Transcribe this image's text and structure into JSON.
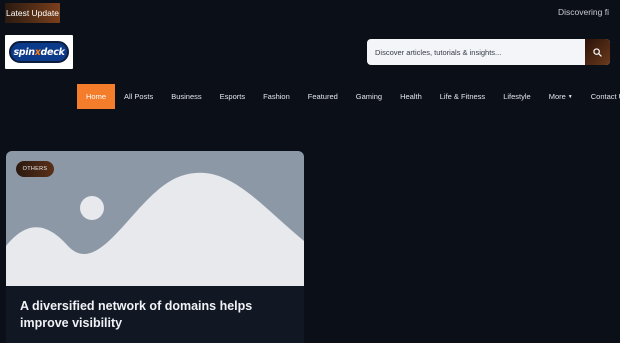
{
  "topbar": {
    "latest_label": "Latest Update",
    "ticker_text": "Discovering fi"
  },
  "logo": {
    "text_before": "spin",
    "text_x": "x",
    "text_after": "deck"
  },
  "search": {
    "placeholder": "Discover articles, tutorials & insights..."
  },
  "nav": {
    "items": [
      {
        "label": "Home"
      },
      {
        "label": "All Posts"
      },
      {
        "label": "Business"
      },
      {
        "label": "Esports"
      },
      {
        "label": "Fashion"
      },
      {
        "label": "Featured"
      },
      {
        "label": "Gaming"
      },
      {
        "label": "Health"
      },
      {
        "label": "Life & Fitness"
      },
      {
        "label": "Lifestyle"
      },
      {
        "label": "More"
      },
      {
        "label": "Contact Us"
      }
    ]
  },
  "card": {
    "category": "OTHERS",
    "title": "A diversified network of domains helps improve visibility"
  },
  "colors": {
    "accent": "#f47d2b",
    "background": "#0b0f17",
    "placeholder_image": "#8d98a6"
  }
}
